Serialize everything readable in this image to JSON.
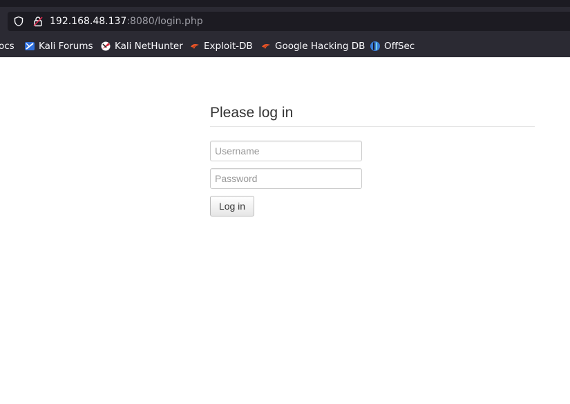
{
  "browser": {
    "url_host": "192.168.48.137",
    "url_rest": ":8080/login.php",
    "bookmarks": [
      {
        "label": "ocs",
        "icon": "docs-icon"
      },
      {
        "label": "Kali Forums",
        "icon": "kali-forums-icon"
      },
      {
        "label": "Kali NetHunter",
        "icon": "kali-nethunter-icon"
      },
      {
        "label": "Exploit-DB",
        "icon": "exploit-db-icon"
      },
      {
        "label": "Google Hacking DB",
        "icon": "google-hacking-db-icon"
      },
      {
        "label": "OffSec",
        "icon": "offsec-icon"
      }
    ]
  },
  "login": {
    "title": "Please log in",
    "username_placeholder": "Username",
    "username_value": "",
    "password_placeholder": "Password",
    "password_value": "",
    "submit_label": "Log in"
  },
  "colors": {
    "chrome_bg": "#2b2a33",
    "urlbar_bg": "#1c1b22",
    "exploit_db_orange": "#e8562a",
    "offsec_blue": "#3a7bd5"
  }
}
